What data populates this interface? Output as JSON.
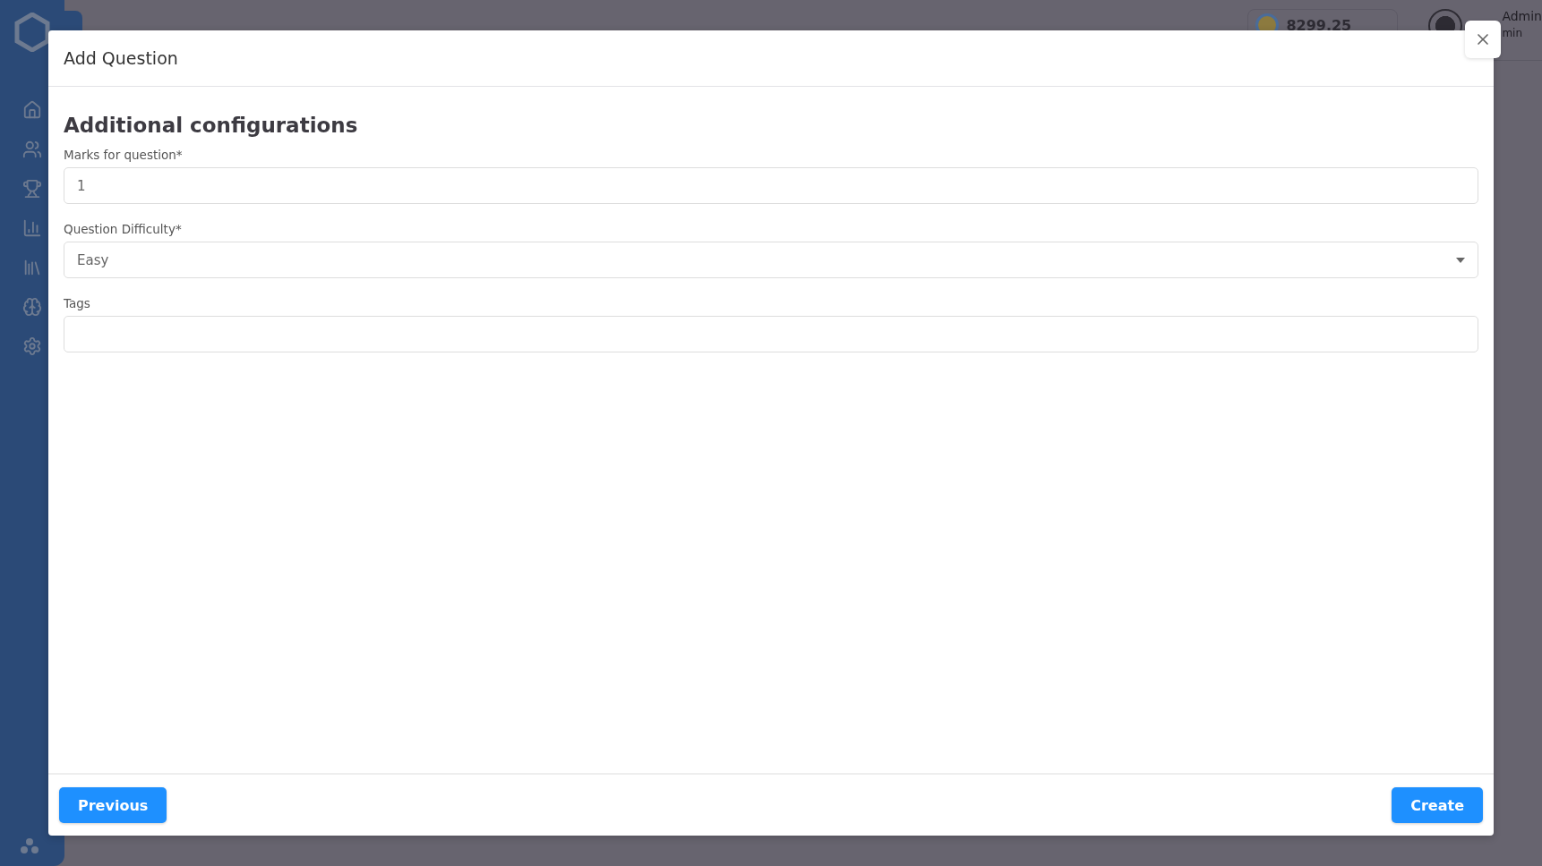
{
  "topbar": {
    "balance": "8299.25",
    "user_name": "Admin",
    "user_role": "min"
  },
  "modal": {
    "title": "Add Question",
    "section_title": "Additional configurations",
    "fields": [
      {
        "kind": "input",
        "label": "Marks for question*",
        "value": "1"
      },
      {
        "kind": "select",
        "label": "Question Difficulty*",
        "value": "Easy"
      },
      {
        "kind": "input",
        "label": "Tags"
      }
    ],
    "buttons": [
      {
        "label": "Previous"
      },
      {
        "label": "Create"
      }
    ]
  }
}
